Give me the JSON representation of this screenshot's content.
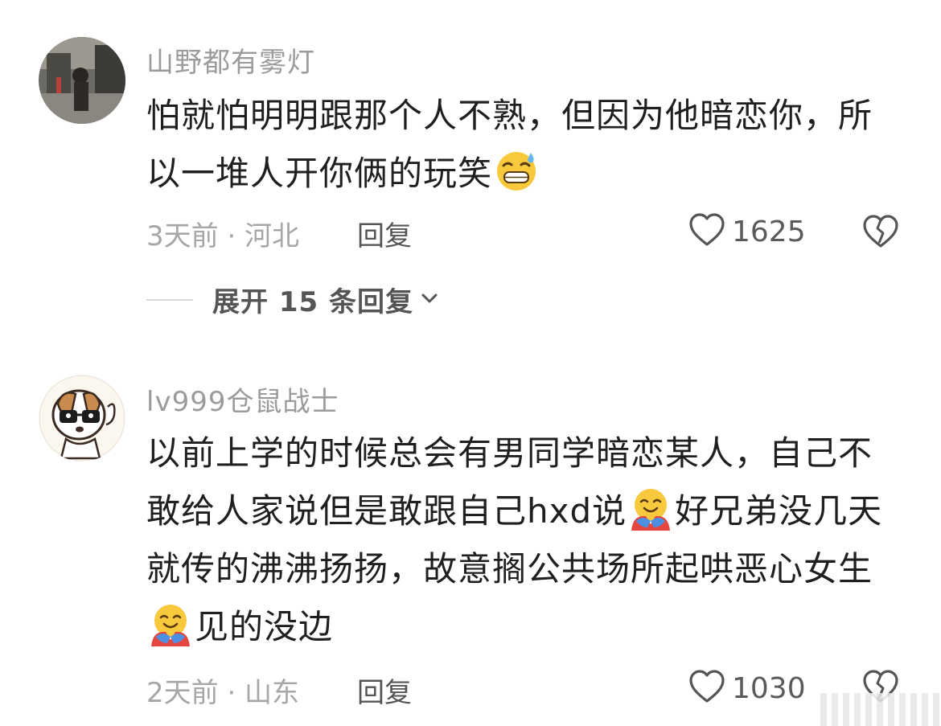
{
  "comments": [
    {
      "username": "山野都有雾灯",
      "text_parts": [
        "怕就怕明明跟那个人不熟，但因为他暗恋你，所以一堆人开你俩的玩笑"
      ],
      "emoji_1": "grin-sweat-emoji",
      "time_location": "3天前 · 河北",
      "reply_label": "回复",
      "likes": "1625",
      "expand_label": "展开 15 条回复"
    },
    {
      "username": "lv999仓鼠战士",
      "text_part_1": "以前上学的时候总会有男同学暗恋某人，自己不敢给人家说但是敢跟自己hxd说",
      "text_part_2": "好兄弟没几天就传的沸沸扬扬，故意搁公共场所起哄恶心女生",
      "text_part_3": "见的没边",
      "emoji": "hugging-face-emoji",
      "time_location": "2天前 · 山东",
      "reply_label": "回复",
      "likes": "1030"
    }
  ],
  "icons": {
    "like": "heart-outline-icon",
    "dislike": "broken-heart-icon",
    "expand": "chevron-down-icon"
  }
}
